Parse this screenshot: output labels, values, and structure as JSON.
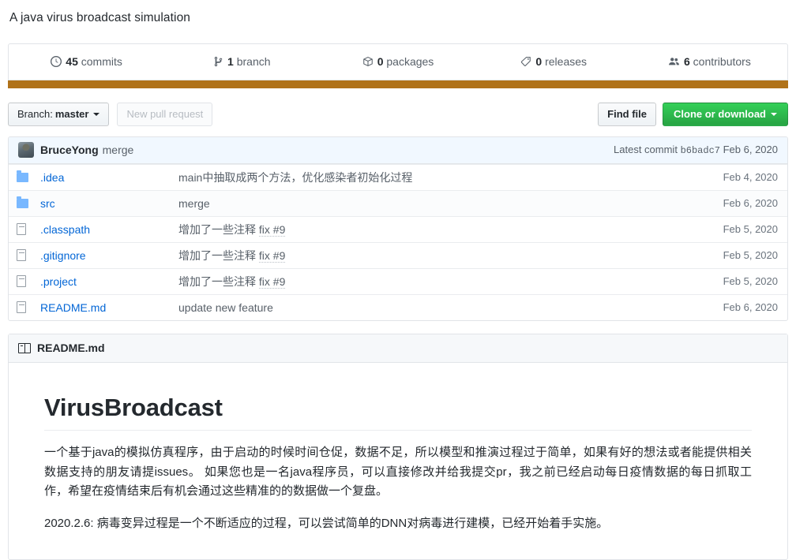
{
  "repo": {
    "description": "A java virus broadcast simulation"
  },
  "stats": [
    {
      "icon": "history-icon",
      "glyph": "◴",
      "count": "45",
      "label": "commits"
    },
    {
      "icon": "branch-icon",
      "glyph": "⑂",
      "count": "1",
      "label": "branch"
    },
    {
      "icon": "package-icon",
      "glyph": "☐",
      "count": "0",
      "label": "packages"
    },
    {
      "icon": "tag-icon",
      "glyph": "⬡",
      "count": "0",
      "label": "releases"
    },
    {
      "icon": "contributors-icon",
      "glyph": "●",
      "count": "6",
      "label": "contributors"
    }
  ],
  "language_bar": [
    {
      "name": "Java",
      "color": "#b07219",
      "percent": 100
    }
  ],
  "toolbar": {
    "branch_prefix": "Branch:",
    "branch_name": "master",
    "new_pull_request": "New pull request",
    "find_file": "Find file",
    "clone_or_download": "Clone or download"
  },
  "commit_bar": {
    "author": "BruceYong",
    "message": "merge",
    "latest_commit_label": "Latest commit",
    "sha": "b6badc7",
    "date": "Feb 6, 2020"
  },
  "files": [
    {
      "type": "folder",
      "name": ".idea",
      "message": "main中抽取成两个方法，优化感染者初始化过程",
      "issue": "",
      "date": "Feb 4, 2020"
    },
    {
      "type": "folder",
      "name": "src",
      "message": "merge",
      "issue": "",
      "date": "Feb 6, 2020"
    },
    {
      "type": "file",
      "name": ".classpath",
      "message": "增加了一些注释",
      "issue": "fix #9",
      "date": "Feb 5, 2020"
    },
    {
      "type": "file",
      "name": ".gitignore",
      "message": "增加了一些注释",
      "issue": "fix #9",
      "date": "Feb 5, 2020"
    },
    {
      "type": "file",
      "name": ".project",
      "message": "增加了一些注释",
      "issue": "fix #9",
      "date": "Feb 5, 2020"
    },
    {
      "type": "file",
      "name": "README.md",
      "message": "update new feature",
      "issue": "",
      "date": "Feb 6, 2020"
    }
  ],
  "readme": {
    "header": "README.md",
    "title": "VirusBroadcast",
    "paragraph1": "一个基于java的模拟仿真程序，由于启动的时候时间仓促，数据不足，所以模型和推演过程过于简单，如果有好的想法或者能提供相关数据支持的朋友请提issues。 如果您也是一名java程序员，可以直接修改并给我提交pr，我之前已经启动每日疫情数据的每日抓取工作，希望在疫情结束后有机会通过这些精准的的数据做一个复盘。",
    "paragraph2": "2020.2.6: 病毒变异过程是一个不断适应的过程，可以尝试简单的DNN对病毒进行建模，已经开始着手实施。"
  }
}
